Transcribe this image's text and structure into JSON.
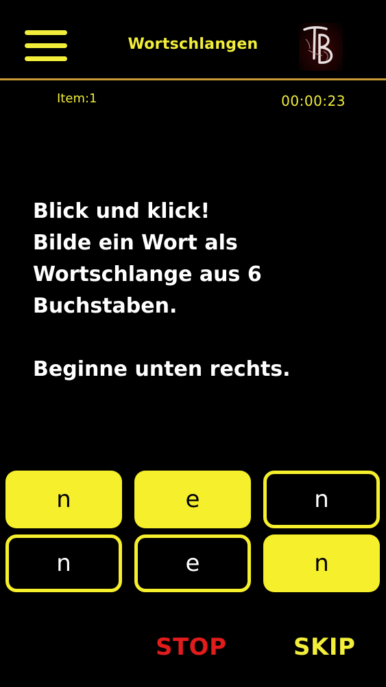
{
  "header": {
    "title": "Wortschlangen",
    "menu_icon": "hamburger-menu-icon",
    "logo_icon": "tb-logo"
  },
  "status": {
    "item": "Item:1",
    "timer": "00:00:23"
  },
  "instructions": {
    "line1": "Blick und klick!",
    "line2": "Bilde ein Wort als",
    "line3": "Wortschlange aus 6",
    "line4": "Buchstaben.",
    "line5": "Beginne unten rechts."
  },
  "tiles": [
    {
      "letter": "n",
      "selected": true
    },
    {
      "letter": "e",
      "selected": true
    },
    {
      "letter": "n",
      "selected": false
    },
    {
      "letter": "n",
      "selected": false
    },
    {
      "letter": "e",
      "selected": false
    },
    {
      "letter": "n",
      "selected": true
    }
  ],
  "actions": {
    "stop": "STOP",
    "skip": "SKIP"
  },
  "colors": {
    "background": "#000000",
    "accent_yellow": "#f6ef2c",
    "divider": "#c99a35",
    "stop_red": "#e21b1b"
  }
}
